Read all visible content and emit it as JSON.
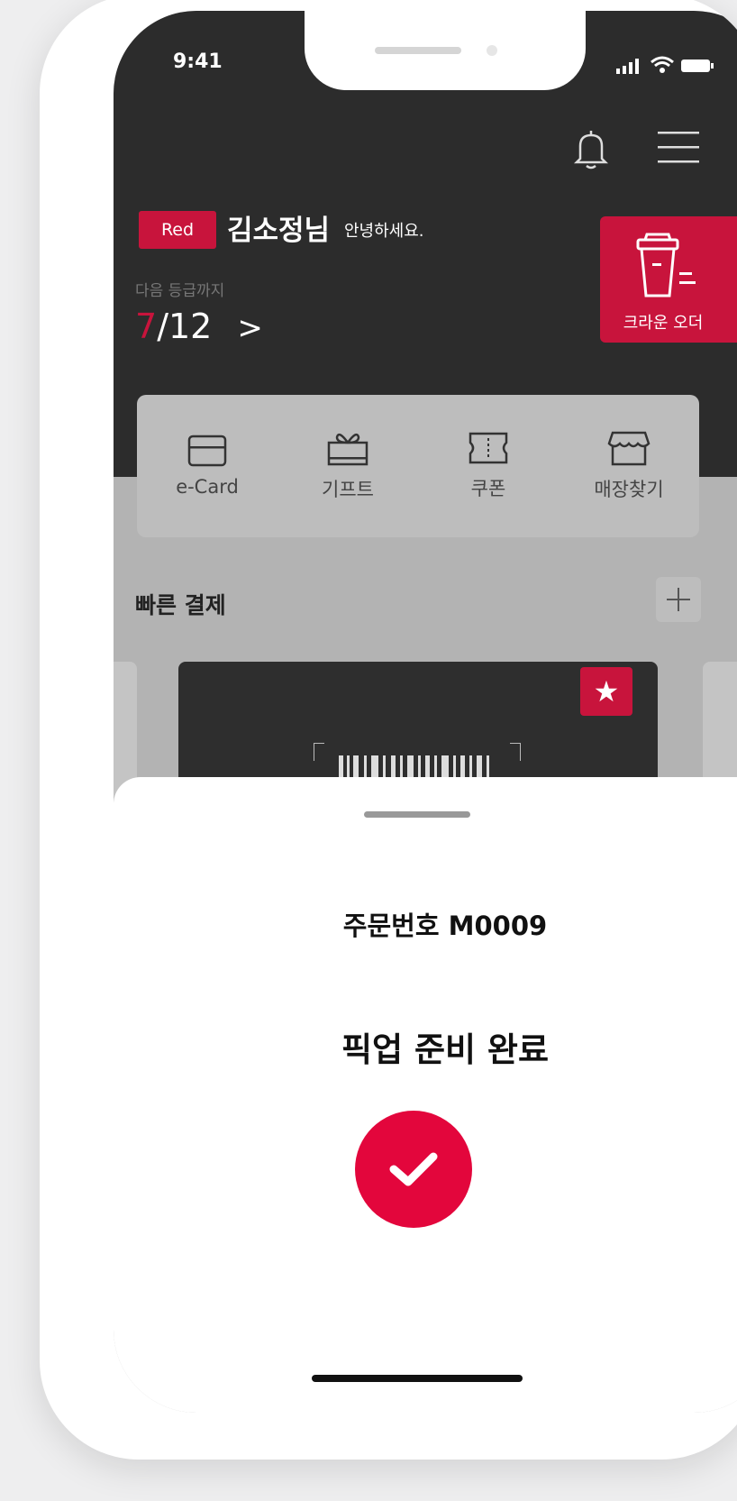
{
  "status_bar": {
    "time": "9:41"
  },
  "header": {
    "grade": "Red",
    "user_name": "김소정님",
    "greeting": "안녕하세요.",
    "next_grade_label": "다음 등급까지",
    "progress_current": "7",
    "progress_total": "/12",
    "progress_chevron": ">"
  },
  "crown_order": {
    "label": "크라운 오더"
  },
  "quick_menu": {
    "items": [
      {
        "label": "e-Card",
        "icon": "card-icon"
      },
      {
        "label": "기프트",
        "icon": "gift-icon"
      },
      {
        "label": "쿠폰",
        "icon": "coupon-icon"
      },
      {
        "label": "매장찾기",
        "icon": "store-icon"
      }
    ]
  },
  "quick_pay": {
    "title": "빠른 결제",
    "add_symbol": "+",
    "favorite_symbol": "★"
  },
  "sheet": {
    "order_number": "주문번호 M0009",
    "status": "픽업 준비 완료"
  },
  "colors": {
    "accent": "#c8143c",
    "check": "#e3063c",
    "dark_bg": "#2c2c2c"
  }
}
